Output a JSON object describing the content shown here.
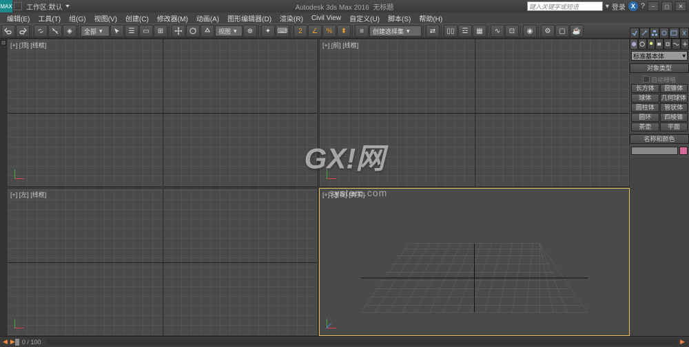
{
  "titlebar": {
    "app_abbr": "MAX",
    "workspace_prefix": "工作区:",
    "workspace_name": "默认",
    "app_title": "Autodesk 3ds Max 2016",
    "doc_title": "无标题",
    "search_placeholder": "键入关键字或短语",
    "login": "登录"
  },
  "menu": {
    "items": [
      "编辑(E)",
      "工具(T)",
      "组(G)",
      "视图(V)",
      "创建(C)",
      "修改器(M)",
      "动画(A)",
      "图形编辑器(D)",
      "渲染(R)",
      "Civil View",
      "自定义(U)",
      "脚本(S)",
      "帮助(H)"
    ]
  },
  "toolbar": {
    "selection_filter": "全部",
    "ref_combo": "创建选择集"
  },
  "viewports": {
    "top_left": "[+] [顶] [线框]",
    "top_right": "[+] [前] [线框]",
    "bottom_left": "[+] [左] [线框]",
    "bottom_right": "[+] [透视] [真实]"
  },
  "cmd_panel": {
    "category": "标准基本体",
    "rollout_type": "对象类型",
    "auto_grid": "自动栅格",
    "objects": [
      [
        "长方体",
        "圆锥体"
      ],
      [
        "球体",
        "几何球体"
      ],
      [
        "圆柱体",
        "管状体"
      ],
      [
        "圆环",
        "四棱锥"
      ],
      [
        "茶壶",
        "平面"
      ]
    ],
    "rollout_name": "名称和颜色"
  },
  "statusbar": {
    "frame": "0 / 100"
  },
  "watermark": {
    "main": "GX!网",
    "sub": "system.com"
  }
}
